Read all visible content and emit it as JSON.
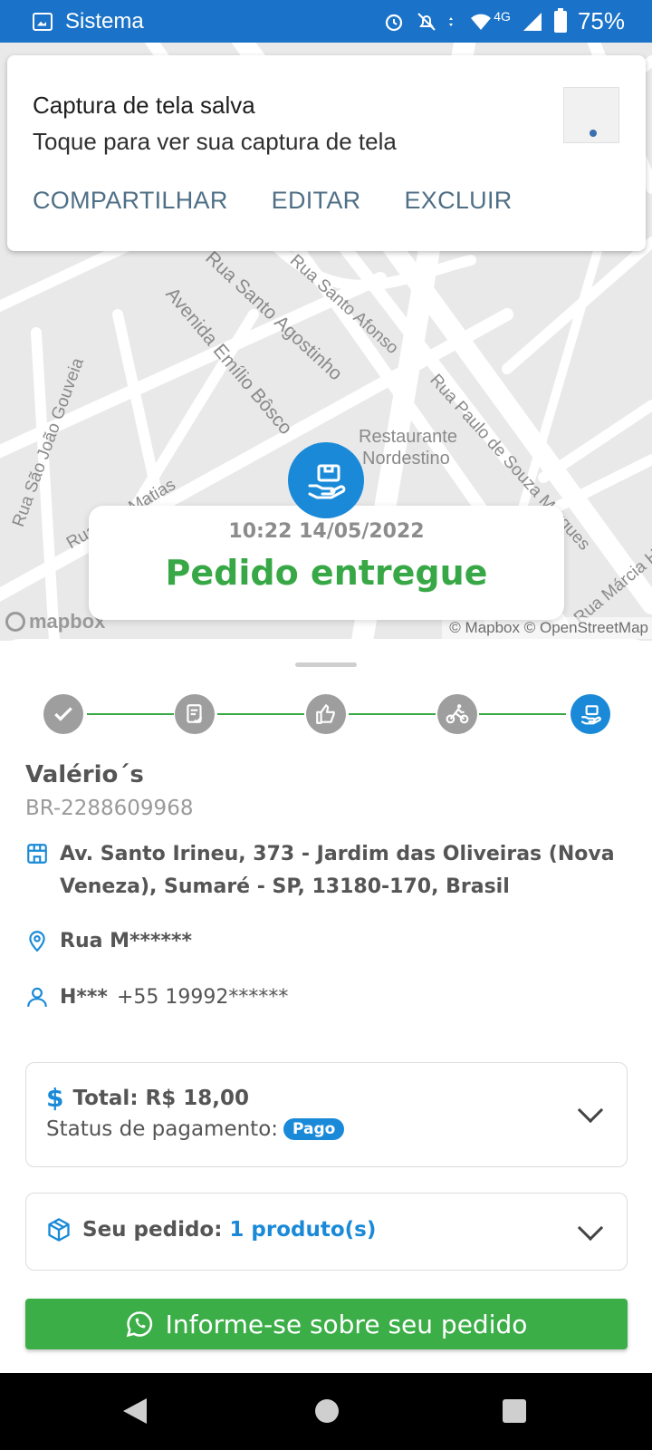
{
  "status_bar": {
    "app_name": "Sistema",
    "network": "4G",
    "battery": "75%",
    "icons": [
      "image-icon",
      "alarm-icon",
      "notifications-off-icon",
      "data-arrows-icon",
      "wifi-icon",
      "signal-icon",
      "battery-icon"
    ]
  },
  "notification": {
    "title": "Captura de tela salva",
    "text": "Toque para ver sua captura de tela",
    "actions": [
      "COMPARTILHAR",
      "EDITAR",
      "EXCLUIR"
    ]
  },
  "map": {
    "streets": [
      "Rua Santo Afonso",
      "Rua Santo Agostinho",
      "Avenida Emílio Bôsco",
      "Rua Paulo de Souza Marques",
      "Rua São João Gouveia",
      "Rua São Matias",
      "Rua Márcia H"
    ],
    "poi": [
      "Restaurante",
      "Nordestino"
    ],
    "logo": "mapbox",
    "attribution": "© Mapbox © OpenStreetMap"
  },
  "delivery": {
    "datetime": "10:22 14/05/2022",
    "status": "Pedido entregue",
    "status_color": "#38a846"
  },
  "progress": {
    "steps": [
      "check-icon",
      "receipt-check-icon",
      "thumbs-up-icon",
      "courier-bike-icon",
      "hand-package-icon"
    ],
    "active_step": 5
  },
  "order": {
    "store_name": "Valério´s",
    "code": "BR-2288609968",
    "store_address": "Av. Santo Irineu, 373 - Jardim das Oliveiras (Nova Veneza), Sumaré - SP, 13180-170, Brasil",
    "delivery_address": "Rua M******",
    "customer_name": "H***",
    "customer_phone": "+55 19992******"
  },
  "payment": {
    "total_label": "Total:",
    "total_value": "R$ 18,00",
    "status_label": "Status de pagamento:",
    "status_badge": "Pago"
  },
  "items": {
    "label": "Seu pedido:",
    "count": "1 produto(s)"
  },
  "actions": {
    "whatsapp": "Informe-se sobre seu pedido"
  },
  "colors": {
    "primary": "#1a8ad8",
    "statusbar": "#1a73c8",
    "success": "#38a846",
    "button": "#3cae48"
  }
}
